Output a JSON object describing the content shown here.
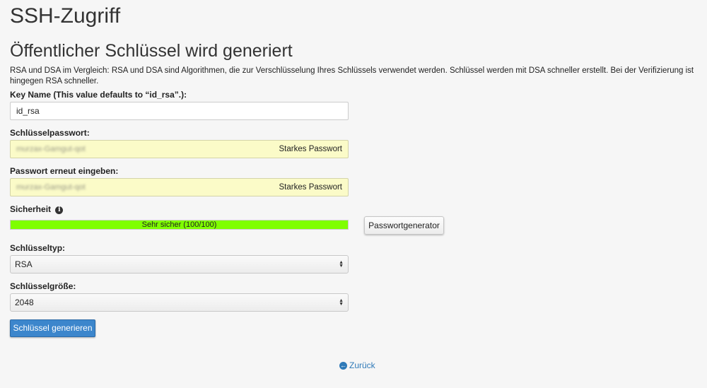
{
  "page": {
    "title": "SSH-Zugriff",
    "section_title": "Öffentlicher Schlüssel wird generiert",
    "intro": "RSA und DSA im Vergleich: RSA und DSA sind Algorithmen, die zur Verschlüsselung Ihres Schlüssels verwendet werden. Schlüssel werden mit DSA schneller erstellt. Bei der Verifizierung ist hingegen RSA schneller."
  },
  "form": {
    "key_name": {
      "label": "Key Name (This value defaults to “id_rsa”.):",
      "value": "id_rsa"
    },
    "password": {
      "label": "Schlüsselpasswort:",
      "value": "murzax-Gamgut-qot",
      "strength_label": "Starkes Passwort"
    },
    "password_confirm": {
      "label": "Passwort erneut eingeben:",
      "value": "murzax-Gamgut-qot",
      "strength_label": "Starkes Passwort"
    },
    "security": {
      "label": "Sicherheit",
      "meter_text": "Sehr sicher (100/100)",
      "score": 100,
      "max": 100,
      "color": "#7fff00"
    },
    "password_generator_button": "Passwortgenerator",
    "key_type": {
      "label": "Schlüsseltyp:",
      "selected": "RSA"
    },
    "key_size": {
      "label": "Schlüsselgröße:",
      "selected": "2048"
    },
    "submit_button": "Schlüssel generieren"
  },
  "footer": {
    "back_link": "Zurück"
  },
  "colors": {
    "primary_button": "#3c86cc",
    "link": "#2f7ab8",
    "password_field_bg": "#fbfbc8"
  }
}
